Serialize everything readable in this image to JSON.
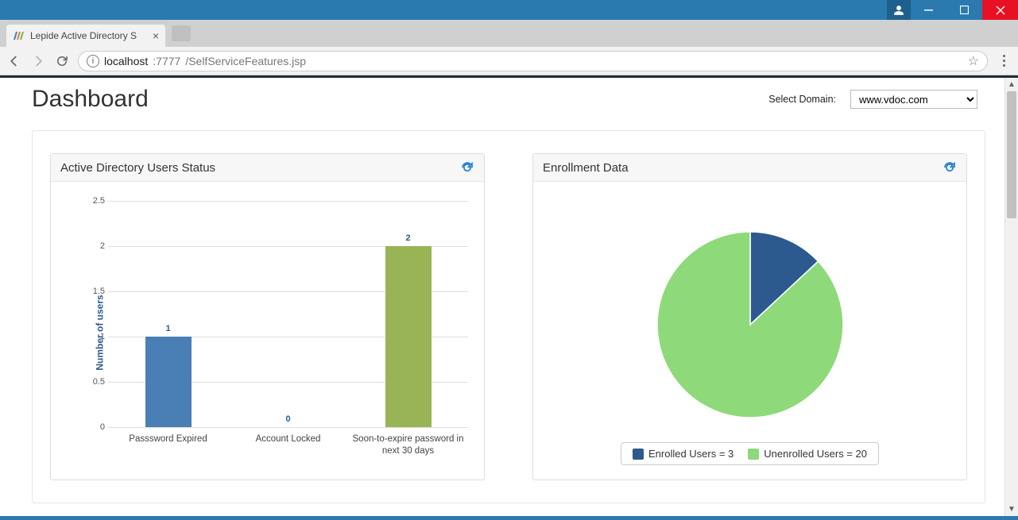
{
  "window": {
    "tab_title": "Lepide Active Directory S"
  },
  "url": {
    "host": "localhost",
    "port": ":7777",
    "path": "/SelfServiceFeatures.jsp"
  },
  "header": {
    "title": "Dashboard",
    "domain_label": "Select Domain:",
    "domain_value": "www.vdoc.com"
  },
  "cards": {
    "status": {
      "title": "Active Directory Users Status"
    },
    "enroll": {
      "title": "Enrollment Data",
      "legend_enrolled": "Enrolled Users = 3",
      "legend_unenrolled": "Unenrolled Users = 20"
    }
  },
  "chart_data": [
    {
      "type": "bar",
      "title": "Active Directory Users Status",
      "ylabel": "Number of users",
      "ylim": [
        0,
        2.5
      ],
      "yticks": [
        0,
        0.5,
        1,
        1.5,
        2,
        2.5
      ],
      "categories": [
        "Passsword Expired",
        "Account Locked",
        "Soon-to-expire password in next 30 days"
      ],
      "values": [
        1,
        0,
        2
      ],
      "colors": [
        "#4a7fb5",
        "#99b455",
        "#99b455"
      ]
    },
    {
      "type": "pie",
      "title": "Enrollment Data",
      "series": [
        {
          "name": "Enrolled Users",
          "value": 3,
          "color": "#2c5a8f"
        },
        {
          "name": "Unenrolled Users",
          "value": 20,
          "color": "#8ed97a"
        }
      ]
    }
  ]
}
